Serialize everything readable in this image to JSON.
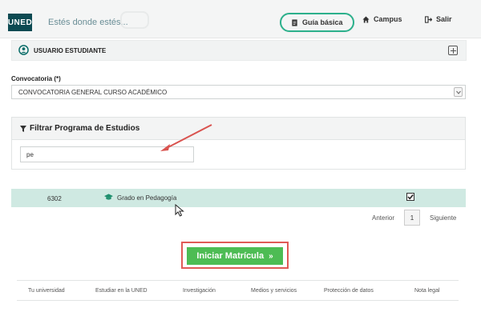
{
  "header": {
    "logo_text": "UNED",
    "slogan": "Estés donde estés...",
    "nav": [
      {
        "label": "Guía básica",
        "icon": "document-icon"
      },
      {
        "label": "Campus",
        "icon": "home-icon"
      },
      {
        "label": "Salir",
        "icon": "logout-icon"
      }
    ]
  },
  "user": {
    "label": "USUARIO ESTUDIANTE",
    "icon": "user-circle-icon",
    "expand_icon": "plus-square-icon"
  },
  "convocatoria": {
    "label": "Convocatoria (*)",
    "selected": "CONVOCATORIA GENERAL CURSO ACADÉMICO"
  },
  "filter": {
    "title": "Filtrar Programa de Estudios",
    "icon": "filter-icon",
    "value": "pe"
  },
  "results": [
    {
      "code": "6302",
      "name": "Grado en Pedagogía",
      "icon": "graduation-cap-icon",
      "checked": true
    }
  ],
  "pagination": {
    "prev": "Anterior",
    "page": "1",
    "next": "Siguiente"
  },
  "start_button": {
    "label": "Iniciar Matrícula",
    "chevron": "»"
  },
  "footer": {
    "links": [
      "Tu universidad",
      "Estudiar en la UNED",
      "Investigación",
      "Medios y servicios",
      "Protección de datos",
      "Nota legal"
    ]
  },
  "colors": {
    "brand": "#0c4a52",
    "highlight_green": "#2bb08b",
    "row_selected": "#cfe9e2",
    "primary_button": "#4dbc54",
    "annotation_red": "#e05a57"
  }
}
